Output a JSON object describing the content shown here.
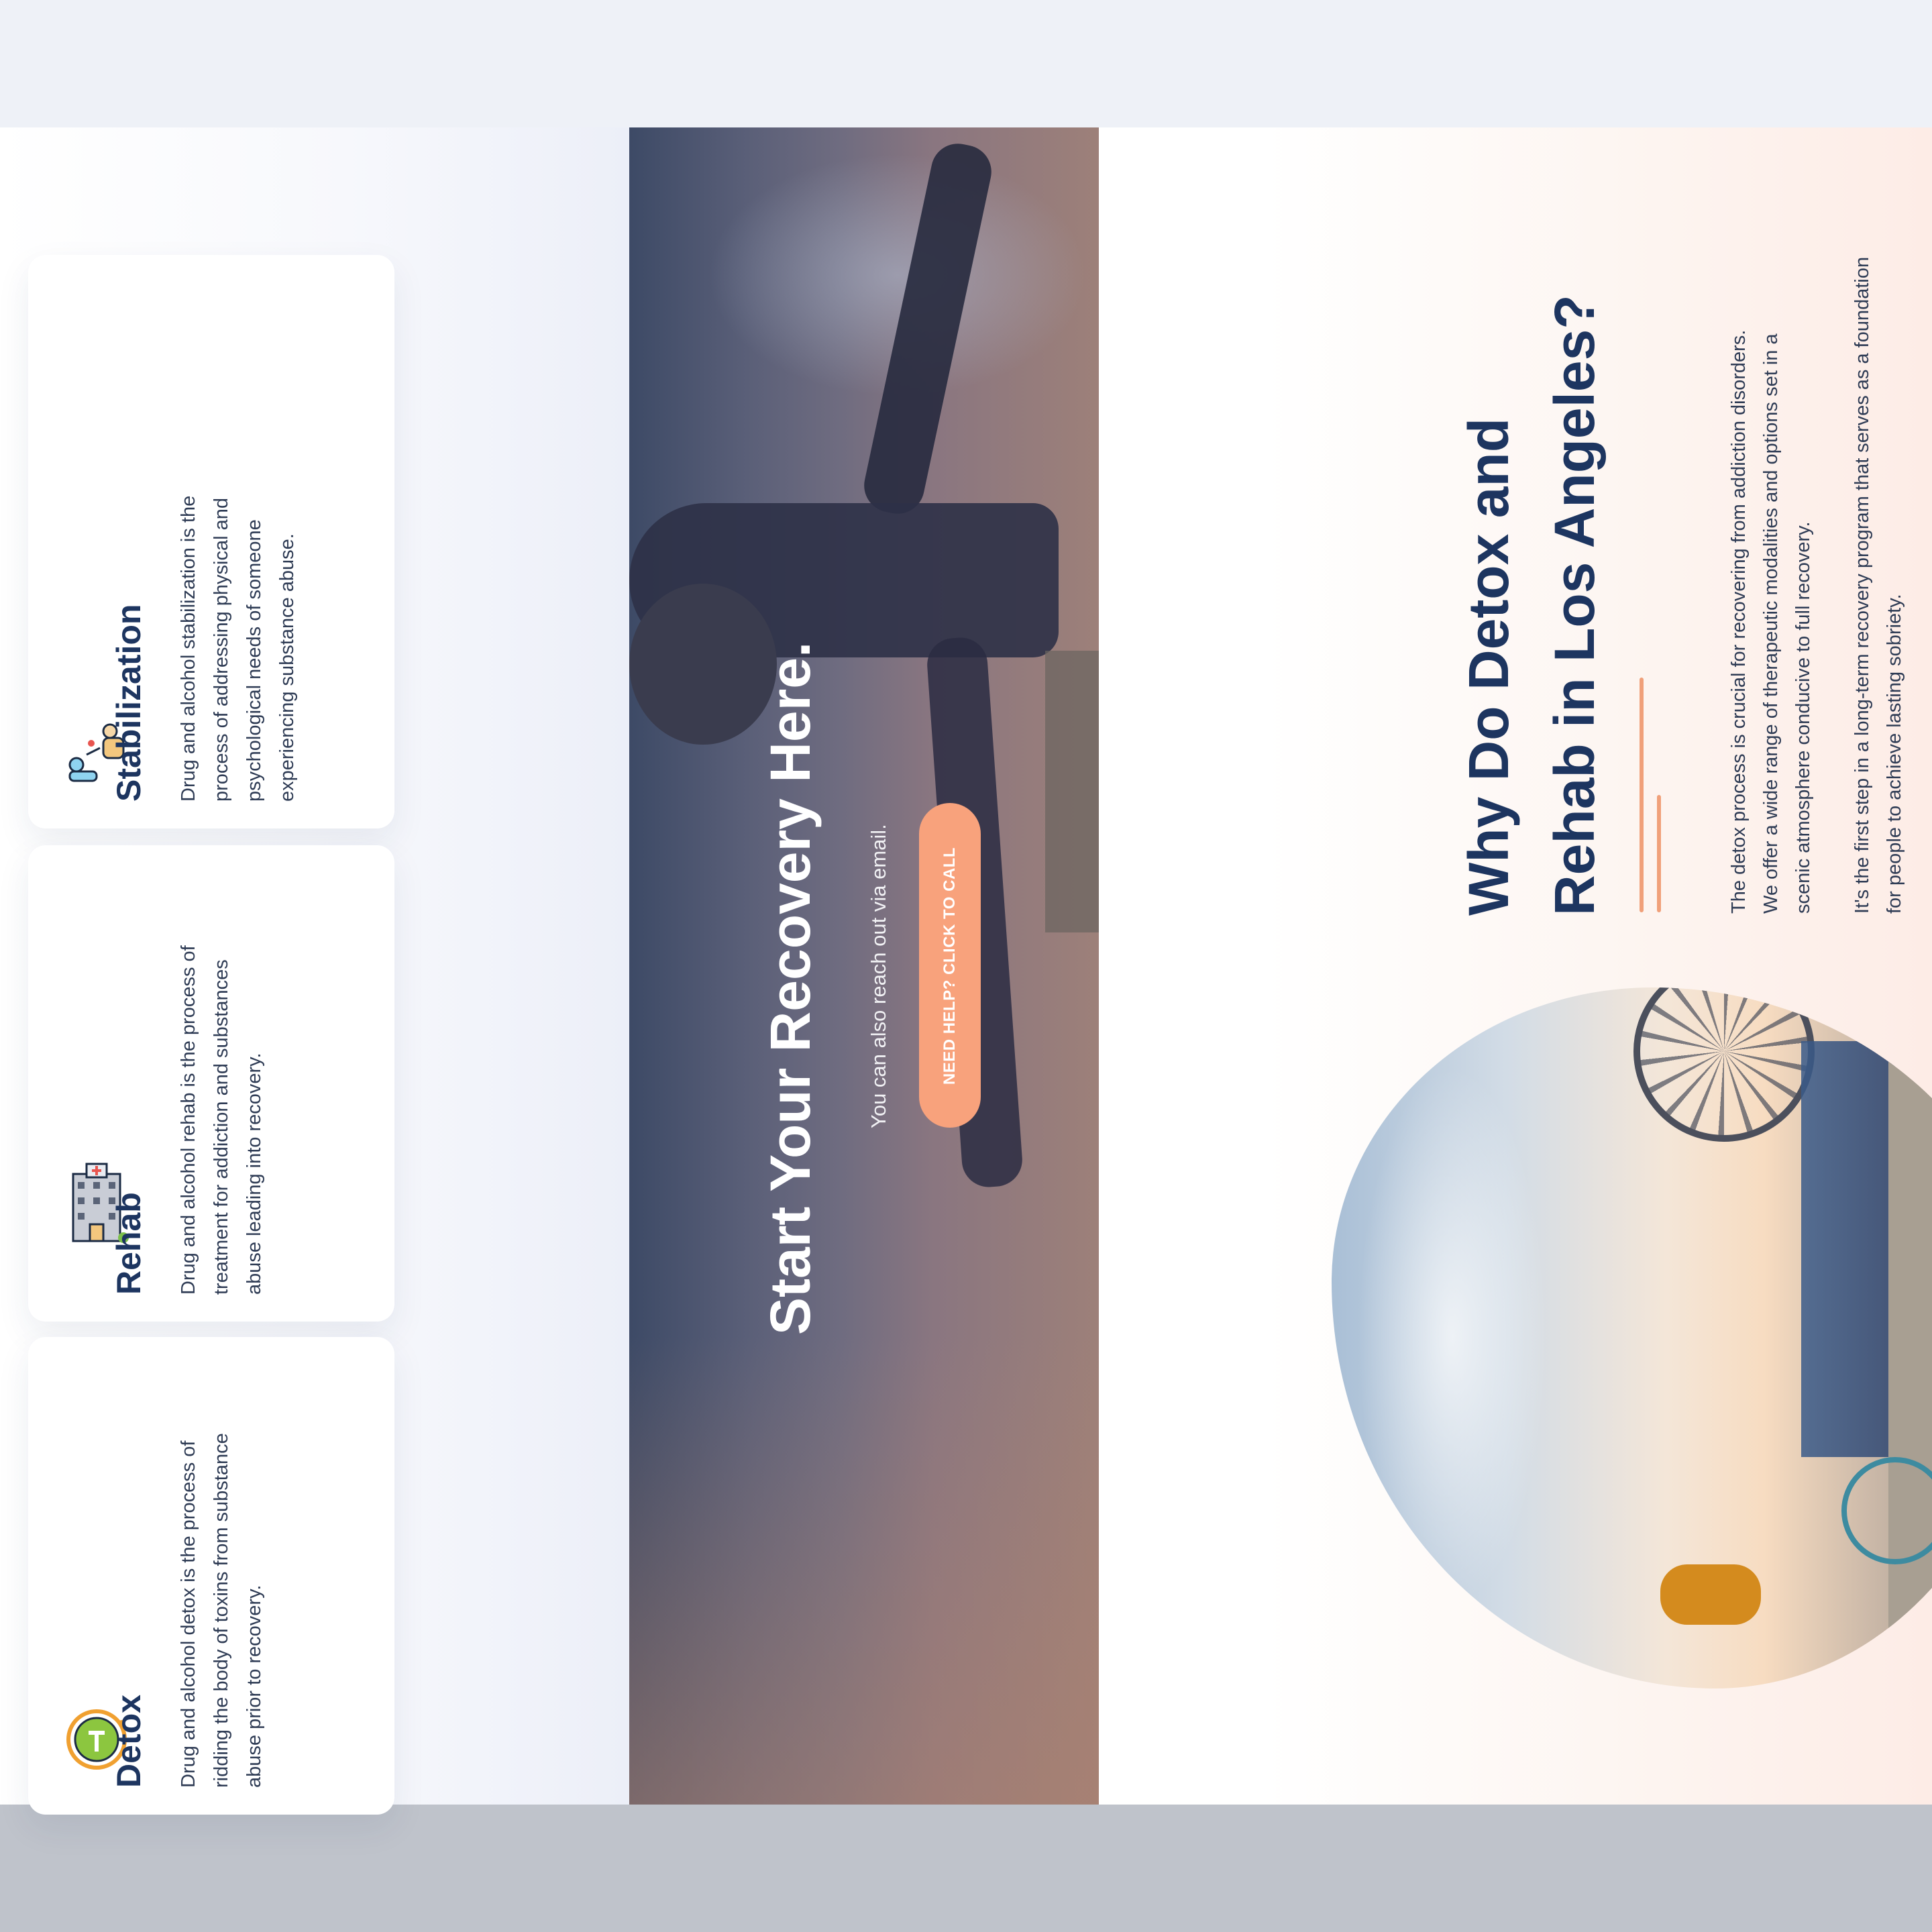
{
  "services": {
    "cards": [
      {
        "title": "Stabilization",
        "text": "Drug and alcohol stabilization is the process of addressing physical and psychological needs of someone experiencing substance abuse.",
        "icon": "stabilization-icon"
      },
      {
        "title": "Rehab",
        "text": "Drug and alcohol rehab is the process of treatment for addiction and substances abuse leading into recovery.",
        "icon": "hospital-building-icon"
      },
      {
        "title": "Detox",
        "text": "Drug and alcohol detox is the process of ridding the body of toxins from substance abuse prior to recovery.",
        "icon": "detox-cycle-icon"
      }
    ]
  },
  "hero": {
    "title": "Start Your Recovery Here.",
    "subtitle": "You can also reach out via email.",
    "cta_label": "NEED HELP? CLICK TO CALL"
  },
  "why": {
    "title": "Why Do Detox and Rehab in Los Angeles?",
    "paragraphs": [
      "The detox process is crucial for recovering from addiction disorders. We offer a wide range of therapeutic modalities and options set in a scenic atmosphere conducive to full recovery.",
      "It's the first step in a long-term recovery program that serves as a foundation for people to achieve lasting sobriety."
    ]
  },
  "colors": {
    "heading": "#1d3560",
    "accent": "#f8a27c",
    "body_text": "#2f3c55"
  }
}
